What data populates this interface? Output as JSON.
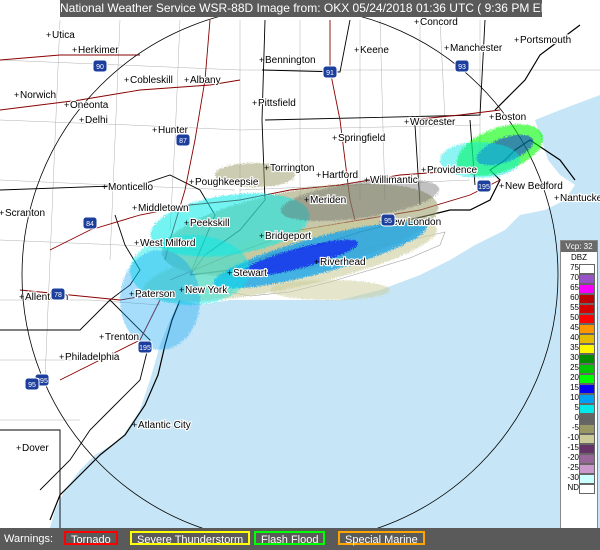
{
  "header": {
    "title": "National Weather Service WSR-88D Image from: OKX 05/24/2018 01:36 UTC ( 9:36 PM EDT)"
  },
  "legend": {
    "vcp": "Vcp: 32",
    "units": "DBZ",
    "levels": [
      {
        "label": "75",
        "color": "#ffffff"
      },
      {
        "label": "70",
        "color": "#9854c6"
      },
      {
        "label": "65",
        "color": "#f800fd"
      },
      {
        "label": "60",
        "color": "#bc0000"
      },
      {
        "label": "55",
        "color": "#d40000"
      },
      {
        "label": "50",
        "color": "#fd0000"
      },
      {
        "label": "45",
        "color": "#fd9500"
      },
      {
        "label": "40",
        "color": "#e5bc00"
      },
      {
        "label": "35",
        "color": "#fdf802"
      },
      {
        "label": "30",
        "color": "#008e00"
      },
      {
        "label": "25",
        "color": "#01c501"
      },
      {
        "label": "20",
        "color": "#02fd02"
      },
      {
        "label": "15",
        "color": "#0300f4"
      },
      {
        "label": "10",
        "color": "#019ff4"
      },
      {
        "label": "5",
        "color": "#04e9e7"
      },
      {
        "label": "0",
        "color": "#646464"
      },
      {
        "label": "-5",
        "color": "#999966"
      },
      {
        "label": "-10",
        "color": "#cccc99"
      },
      {
        "label": "-15",
        "color": "#663366"
      },
      {
        "label": "-20",
        "color": "#996699"
      },
      {
        "label": "-25",
        "color": "#cc99cc"
      },
      {
        "label": "-30",
        "color": "#ccffff"
      },
      {
        "label": "ND",
        "color": "#ffffff"
      }
    ]
  },
  "warnings": {
    "label": "Warnings:",
    "items": [
      {
        "label": "Tornado",
        "color": "#ff0000"
      },
      {
        "label": "Severe Thunderstorm",
        "color": "#ffff00"
      },
      {
        "label": "Flash Flood",
        "color": "#00ff00"
      },
      {
        "label": "Special Marine",
        "color": "#ffa500"
      }
    ]
  },
  "cities": [
    "Utica",
    "Herkimer",
    "Cobleskill",
    "Albany",
    "Norwich",
    "Oneonta",
    "Delhi",
    "Hunter",
    "Bennington",
    "Keene",
    "Concord",
    "Manchester",
    "Portsmouth",
    "Pittsfield",
    "Worcester",
    "Boston",
    "Springfield",
    "Torrington",
    "Hartford",
    "Willimantic",
    "Providence",
    "New Bedford",
    "Nantucket",
    "Monticello",
    "Poughkeepsie",
    "Middletown",
    "Meriden",
    "New London",
    "Peekskill",
    "Bridgeport",
    "Scranton",
    "West Milford",
    "Riverhead",
    "Stewart",
    "Paterson",
    "New York",
    "Allentown",
    "Trenton",
    "Philadelphia",
    "Atlantic City",
    "Dover"
  ],
  "highways": [
    "90",
    "91",
    "93",
    "87",
    "84",
    "95",
    "195",
    "78",
    "195",
    "295",
    "95"
  ]
}
